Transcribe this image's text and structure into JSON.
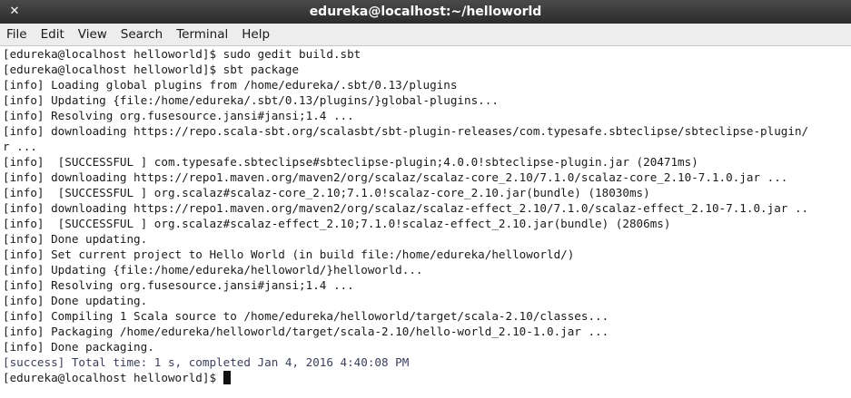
{
  "window": {
    "title": "edureka@localhost:~/helloworld",
    "close_glyph": "✕"
  },
  "menu": [
    "File",
    "Edit",
    "View",
    "Search",
    "Terminal",
    "Help"
  ],
  "terminal": {
    "lines": [
      "[edureka@localhost helloworld]$ sudo gedit build.sbt",
      "[edureka@localhost helloworld]$ sbt package",
      "[info] Loading global plugins from /home/edureka/.sbt/0.13/plugins",
      "[info] Updating {file:/home/edureka/.sbt/0.13/plugins/}global-plugins...",
      "[info] Resolving org.fusesource.jansi#jansi;1.4 ...",
      "[info] downloading https://repo.scala-sbt.org/scalasbt/sbt-plugin-releases/com.typesafe.sbteclipse/sbteclipse-plugin/",
      "r ...",
      "[info]  [SUCCESSFUL ] com.typesafe.sbteclipse#sbteclipse-plugin;4.0.0!sbteclipse-plugin.jar (20471ms)",
      "[info] downloading https://repo1.maven.org/maven2/org/scalaz/scalaz-core_2.10/7.1.0/scalaz-core_2.10-7.1.0.jar ...",
      "[info]  [SUCCESSFUL ] org.scalaz#scalaz-core_2.10;7.1.0!scalaz-core_2.10.jar(bundle) (18030ms)",
      "[info] downloading https://repo1.maven.org/maven2/org/scalaz/scalaz-effect_2.10/7.1.0/scalaz-effect_2.10-7.1.0.jar ..",
      "[info]  [SUCCESSFUL ] org.scalaz#scalaz-effect_2.10;7.1.0!scalaz-effect_2.10.jar(bundle) (2806ms)",
      "[info] Done updating.",
      "[info] Set current project to Hello World (in build file:/home/edureka/helloworld/)",
      "[info] Updating {file:/home/edureka/helloworld/}helloworld...",
      "[info] Resolving org.fusesource.jansi#jansi;1.4 ...",
      "[info] Done updating.",
      "[info] Compiling 1 Scala source to /home/edureka/helloworld/target/scala-2.10/classes...",
      "[info] Packaging /home/edureka/helloworld/target/scala-2.10/hello-world_2.10-1.0.jar ...",
      "[info] Done packaging.",
      "[success] Total time: 1 s, completed Jan 4, 2016 4:40:08 PM"
    ],
    "prompt": "[edureka@localhost helloworld]$ "
  },
  "colors": {
    "titlebar": "#2b2b2b",
    "menubar": "#ededed",
    "terminal_bg": "#ffffff",
    "text": "#1a1a1a"
  }
}
